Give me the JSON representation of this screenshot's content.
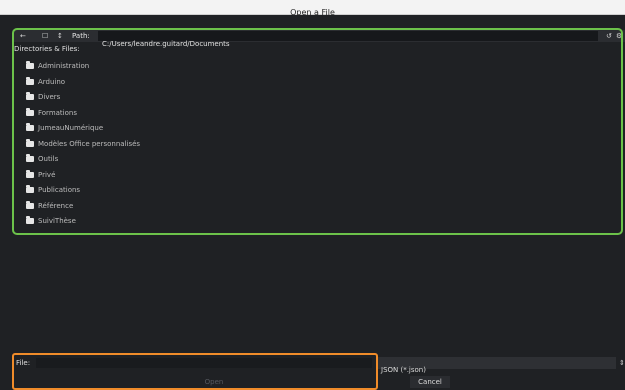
{
  "window": {
    "title": "Open a File"
  },
  "toolbar": {
    "back_icon": "arrow-left-icon",
    "new_folder_icon": "new-folder-icon",
    "sort_icon": "sort-icon",
    "path_label": "Path:",
    "path_value": "C:/Users/leandre.guitard/Documents",
    "refresh_icon": "refresh-icon",
    "settings_icon": "gear-icon"
  },
  "list_header": "Directories & Files:",
  "items": [
    {
      "label": "Administration"
    },
    {
      "label": "Arduino"
    },
    {
      "label": "Divers"
    },
    {
      "label": "Formations"
    },
    {
      "label": "JumeauNumérique"
    },
    {
      "label": "Modèles Office personnalisés"
    },
    {
      "label": "Outils"
    },
    {
      "label": "Privé"
    },
    {
      "label": "Publications"
    },
    {
      "label": "Référence"
    },
    {
      "label": "SuiviThèse"
    }
  ],
  "footer": {
    "file_label": "File:",
    "file_value": "",
    "filter_value": "JSON (*.json)",
    "open_label": "Open",
    "cancel_label": "Cancel"
  },
  "colors": {
    "highlight_list": "#6cc24a",
    "highlight_footer": "#f08c2a",
    "background": "#1f2124"
  }
}
